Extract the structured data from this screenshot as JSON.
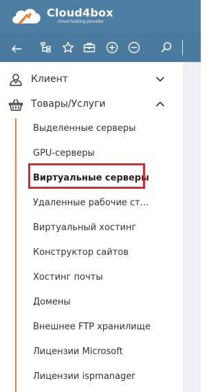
{
  "brand": {
    "title": "Cloud4box",
    "subtitle": "cloud hosting provider"
  },
  "toolbar": {
    "icons": [
      "back-arrow-icon",
      "tree-icon",
      "star-icon",
      "briefcase-icon",
      "plus-circle-icon",
      "minus-circle-icon",
      "search-icon"
    ]
  },
  "sidebar": {
    "sections": [
      {
        "label": "Клиент",
        "icon": "user-icon",
        "expanded": false
      },
      {
        "label": "Товары/Услуги",
        "icon": "basket-icon",
        "expanded": true
      }
    ],
    "items": [
      {
        "label": "Выделенные серверы"
      },
      {
        "label": "GPU-серверы"
      },
      {
        "label": "Виртуальные серверы",
        "active": true
      },
      {
        "label": "Удаленные рабочие ст…"
      },
      {
        "label": "Виртуальный хостинг"
      },
      {
        "label": "Конструктор сайтов"
      },
      {
        "label": "Хостинг почты"
      },
      {
        "label": "Домены"
      },
      {
        "label": "Внешнее FTP хранилище"
      },
      {
        "label": "Лицензии Microsoft"
      },
      {
        "label": "Лицензии ispmanager"
      }
    ]
  },
  "colors": {
    "header": "#4e7fa3",
    "toolbar": "#4a7a9e",
    "accent": "#ef7d2d",
    "highlight": "#e0242a"
  }
}
